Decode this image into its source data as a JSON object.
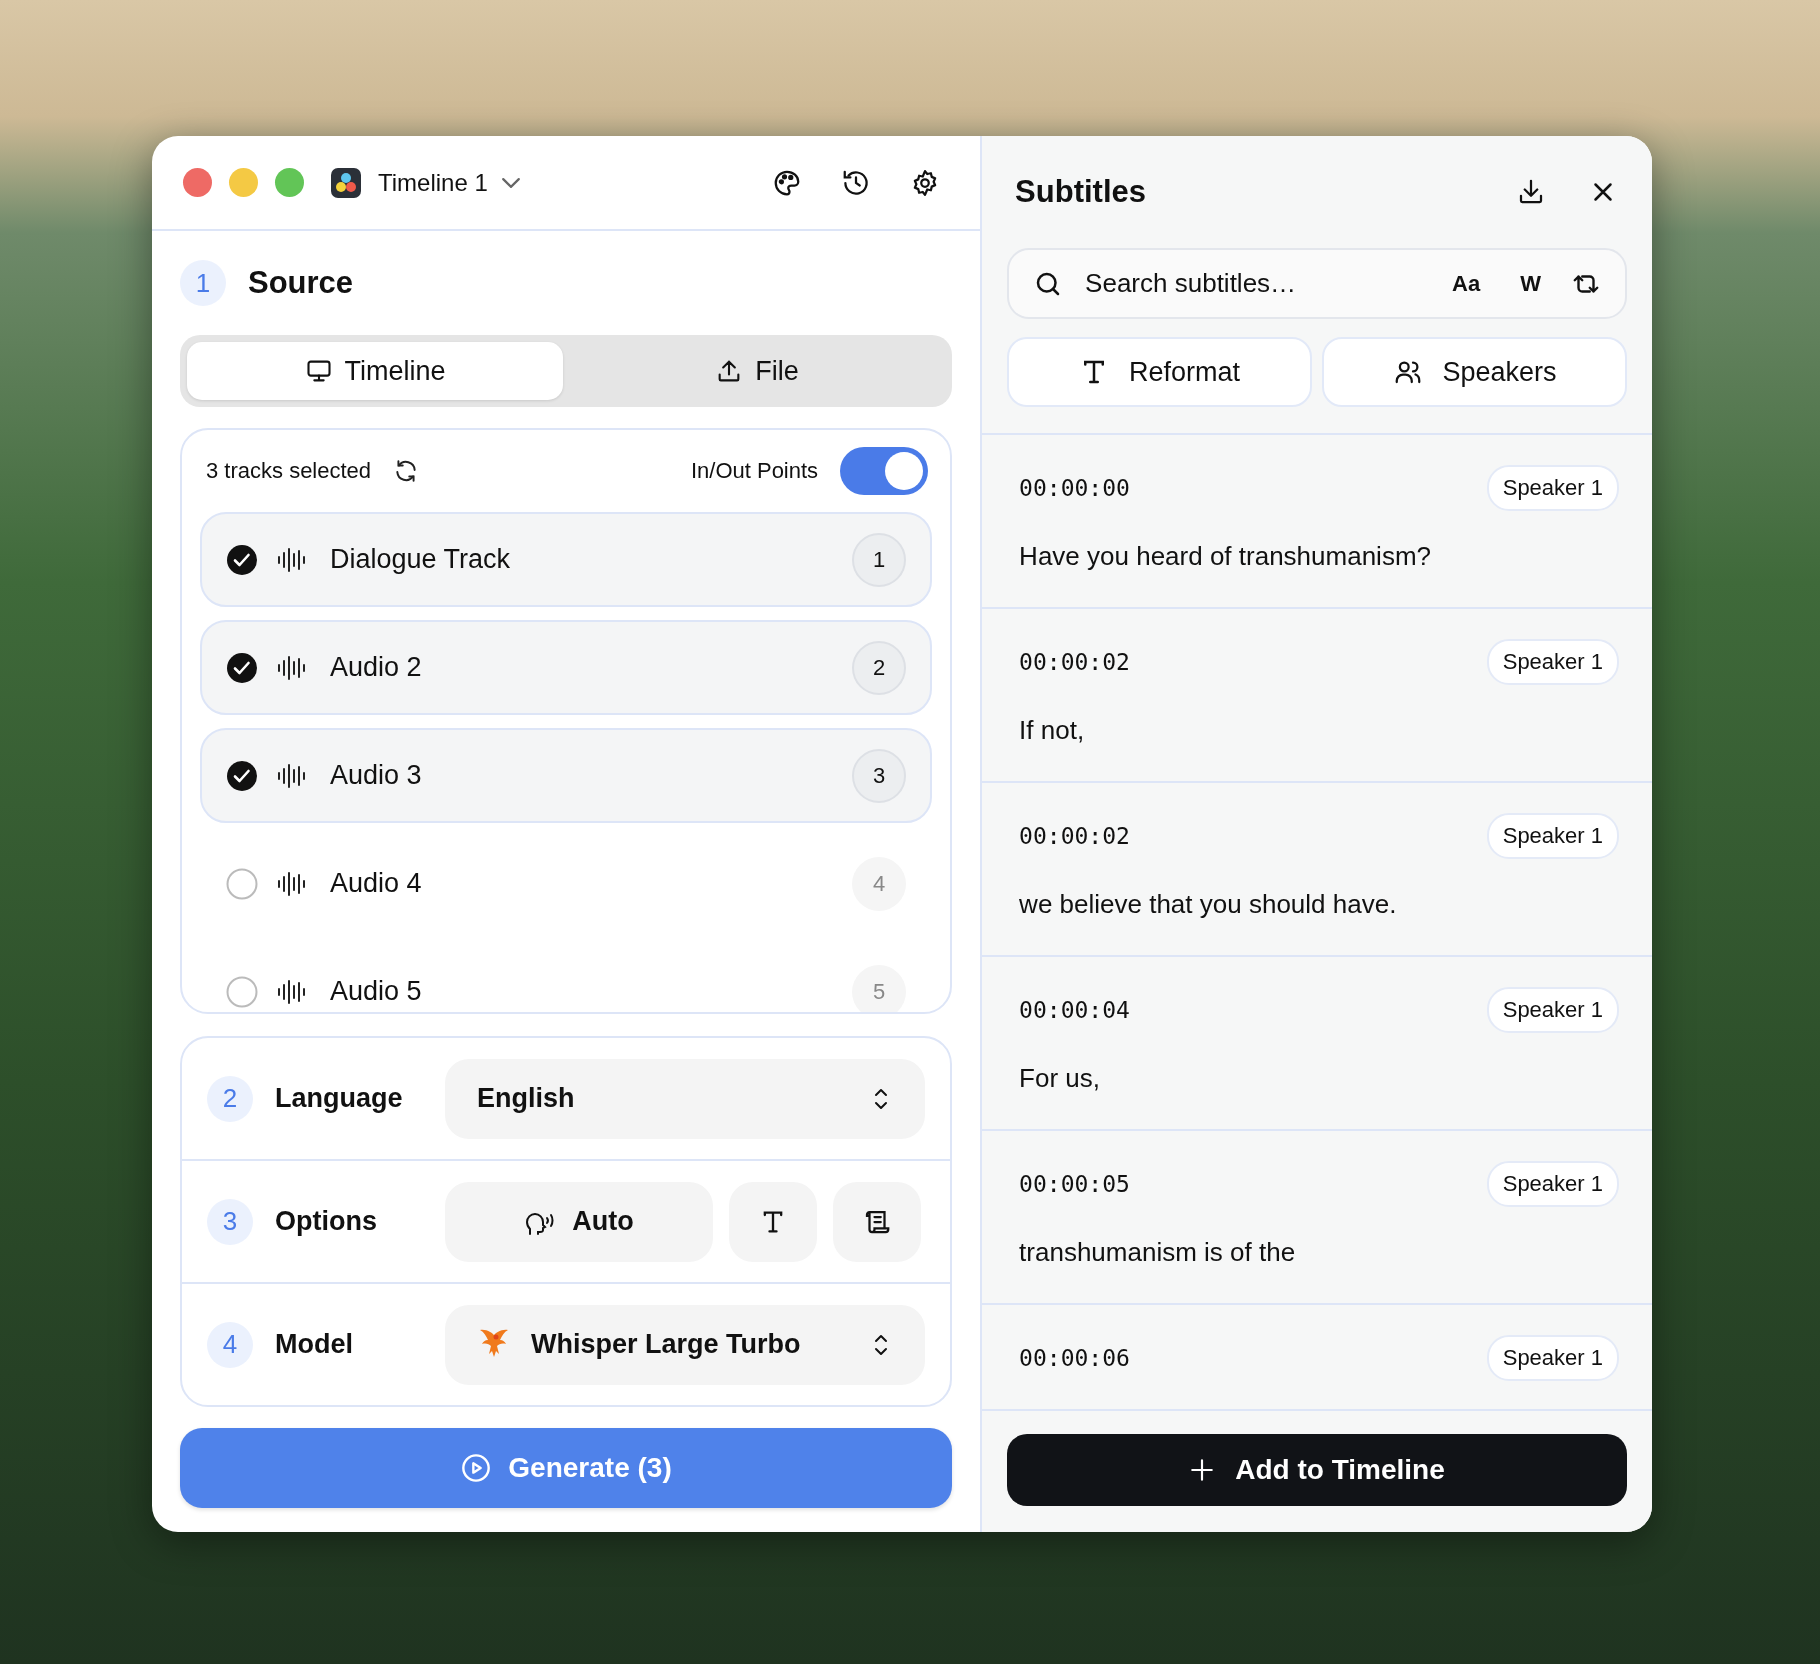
{
  "window": {
    "title": "Timeline 1"
  },
  "source": {
    "number": "1",
    "title": "Source",
    "tabs": [
      {
        "label": "Timeline",
        "selected": true,
        "kind": "monitor"
      },
      {
        "label": "File",
        "selected": false,
        "kind": "upload"
      }
    ],
    "tracks_summary": "3 tracks selected",
    "in_out": {
      "label": "In/Out Points",
      "on": true
    },
    "tracks": [
      {
        "name": "Dialogue Track",
        "number": "1",
        "checked": true
      },
      {
        "name": "Audio 2",
        "number": "2",
        "checked": true
      },
      {
        "name": "Audio 3",
        "number": "3",
        "checked": true
      },
      {
        "name": "Audio 4",
        "number": "4",
        "checked": false
      },
      {
        "name": "Audio 5",
        "number": "5",
        "checked": false
      }
    ]
  },
  "language": {
    "number": "2",
    "label": "Language",
    "value": "English"
  },
  "options": {
    "number": "3",
    "label": "Options",
    "mode": "Auto"
  },
  "model": {
    "number": "4",
    "label": "Model",
    "value": "Whisper Large Turbo"
  },
  "generate_button": "Generate (3)",
  "subtitles": {
    "title": "Subtitles",
    "search": {
      "placeholder": "Search subtitles…"
    },
    "search_toggles": [
      "Aa",
      "W"
    ],
    "actions": [
      {
        "label": "Reformat",
        "kind": "text"
      },
      {
        "label": "Speakers",
        "kind": "people"
      }
    ],
    "items": [
      {
        "time": "00:00:00",
        "speaker": "Speaker 1",
        "text": "Have you heard of transhumanism?"
      },
      {
        "time": "00:00:02",
        "speaker": "Speaker 1",
        "text": "If not,"
      },
      {
        "time": "00:00:02",
        "speaker": "Speaker 1",
        "text": "we believe that you should have."
      },
      {
        "time": "00:00:04",
        "speaker": "Speaker 1",
        "text": "For us,"
      },
      {
        "time": "00:00:05",
        "speaker": "Speaker 1",
        "text": "transhumanism is of the"
      },
      {
        "time": "00:00:06",
        "speaker": "Speaker 1"
      }
    ],
    "add_button": "Add to Timeline"
  }
}
